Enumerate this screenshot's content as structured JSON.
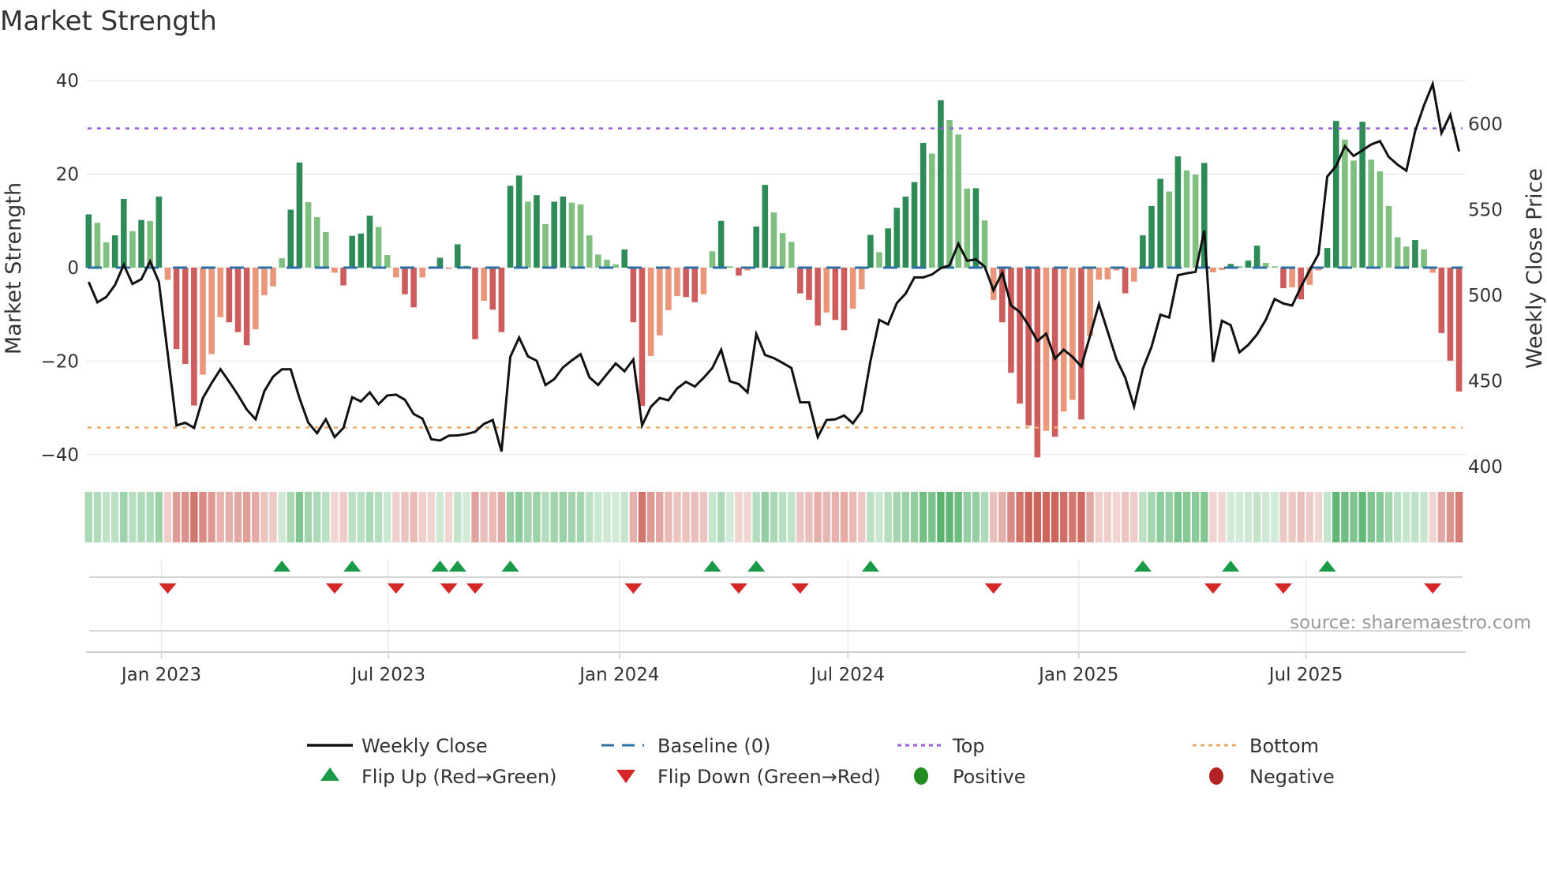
{
  "chart_data": {
    "type": "bar",
    "title": "Market Strength",
    "ylabel": "Market Strength",
    "y2label": "Weekly Close Price",
    "ylim": [
      -42,
      42
    ],
    "y2lim": [
      395,
      630
    ],
    "yticks": [
      "40",
      "20",
      "0",
      "−20",
      "−40"
    ],
    "yticks_values": [
      40,
      20,
      0,
      -20,
      -40
    ],
    "y2ticks": [
      "600",
      "550",
      "500",
      "450",
      "400"
    ],
    "y2ticks_values": [
      600,
      550,
      500,
      450,
      400
    ],
    "xticks": [
      {
        "label": "Jan 2023",
        "date": "2023-01-01"
      },
      {
        "label": "Jul 2023",
        "date": "2023-07-01"
      },
      {
        "label": "Jan 2024",
        "date": "2024-01-01"
      },
      {
        "label": "Jul 2024",
        "date": "2024-07-01"
      },
      {
        "label": "Jan 2025",
        "date": "2025-01-01"
      },
      {
        "label": "Jul 2025",
        "date": "2025-07-01"
      }
    ],
    "start_date": "2022-11-04",
    "frequency": "weekly",
    "grid": true,
    "top_level": 29.8,
    "bottom_level": -34.2,
    "baseline": 0,
    "market_strength": [
      11.4,
      9.6,
      5.4,
      6.9,
      14.7,
      7.8,
      10.2,
      10,
      15.2,
      -2.6,
      -17.4,
      -20.6,
      -29.5,
      -22.9,
      -18.5,
      -10.6,
      -11.7,
      -13.8,
      -16.6,
      -13.2,
      -5.9,
      -4,
      2,
      12.4,
      22.5,
      14,
      10.8,
      7.6,
      -1.1,
      -3.8,
      6.8,
      7.3,
      11.1,
      8.7,
      2.7,
      -2.1,
      -5.7,
      -8.5,
      -2.1,
      -0.3,
      2.1,
      -0.3,
      5,
      0.4,
      -15.3,
      -7.1,
      -9,
      -13.8,
      17.5,
      19.7,
      14.1,
      15.5,
      9.3,
      14.1,
      15.2,
      13.9,
      13.5,
      6.9,
      2.8,
      1.7,
      0.7,
      3.9,
      -11.7,
      -29.6,
      -18.9,
      -14.5,
      -9.1,
      -6.1,
      -6.3,
      -7.4,
      -5.7,
      3.5,
      10,
      0.3,
      -1.7,
      -0.6,
      8.8,
      17.7,
      11.8,
      7.4,
      5.5,
      -5.5,
      -6.9,
      -12.4,
      -9.6,
      -11.2,
      -13.4,
      -8.8,
      -4.6,
      7,
      3.3,
      8.4,
      12.8,
      15.2,
      18.3,
      26.7,
      24.4,
      35.8,
      31.6,
      28.5,
      16.9,
      17,
      10.1,
      -6.9,
      -11.7,
      -22.5,
      -29.1,
      -33.8,
      -40.6,
      -34.9,
      -36.2,
      -30.8,
      -28.3,
      -32.5,
      -14.6,
      -2.6,
      -2.5,
      -0.6,
      -5.5,
      -3,
      6.9,
      13.2,
      19,
      16.3,
      23.8,
      20.8,
      19.9,
      22.4,
      -1,
      -0.5,
      0.8,
      0.3,
      1.5,
      4.7,
      1,
      0.3,
      -4.4,
      -4.2,
      -6.8,
      -3.7,
      -0.6,
      4.2,
      31.4,
      27.4,
      22.9,
      31.2,
      23.1,
      20.6,
      13.2,
      6.5,
      4.5,
      5.9,
      3.9,
      -1.1,
      -14,
      -19.9,
      -26.5
    ],
    "weekly_close": [
      507.8,
      495.9,
      499,
      506,
      517.8,
      506.6,
      509.4,
      519.8,
      507.8,
      466,
      424,
      425.6,
      422.6,
      440,
      448.7,
      456.8,
      449.5,
      441.8,
      433.3,
      427.6,
      444,
      452.5,
      456.8,
      456.8,
      440,
      425.6,
      419.5,
      427.6,
      417.2,
      422.6,
      440.5,
      438,
      443.3,
      436.4,
      441.5,
      442,
      439,
      430.7,
      428,
      416,
      415.2,
      418,
      418.2,
      419,
      420.3,
      424.9,
      427.2,
      408.8,
      464,
      475.3,
      464.4,
      461.8,
      447.6,
      451,
      457.9,
      462,
      465.6,
      452.2,
      447.6,
      454,
      460.2,
      455.6,
      462.5,
      424,
      434.9,
      440,
      438.7,
      445.6,
      449.5,
      446.7,
      451.8,
      457.5,
      468.2,
      449.8,
      448.2,
      443.3,
      477.4,
      465.1,
      463.3,
      460.5,
      457.5,
      437.5,
      437.5,
      417.2,
      427.2,
      427.6,
      429.8,
      425.2,
      432.3,
      461.8,
      485.6,
      483,
      495.5,
      500.9,
      510.4,
      510.4,
      512.1,
      515.8,
      517.4,
      530.1,
      520.1,
      520.9,
      516.7,
      502.9,
      513.2,
      494,
      490.2,
      482.5,
      473.3,
      477.6,
      463,
      468.2,
      464,
      458.4,
      476.4,
      494.9,
      478.8,
      462.7,
      452,
      435,
      457,
      470,
      488.6,
      487,
      511.7,
      512.8,
      513.7,
      537.8,
      461,
      485.1,
      482.6,
      466.7,
      471,
      477.1,
      485.6,
      497.8,
      495.2,
      494,
      504.8,
      514.7,
      524,
      569.3,
      575.4,
      587,
      581.3,
      584.6,
      588,
      590,
      580.8,
      576.2,
      572.7,
      595.7,
      610.8,
      623.3,
      594.6,
      605.4,
      583.9
    ],
    "flip_up_weeks": [
      22,
      30,
      40,
      42,
      48,
      71,
      76,
      89,
      120,
      130,
      141
    ],
    "flip_down_weeks": [
      9,
      28,
      35,
      41,
      44,
      62,
      74,
      81,
      103,
      128,
      136,
      153
    ],
    "legend": {
      "placement": "bottom",
      "items": [
        {
          "label": "Weekly Close",
          "kind": "line"
        },
        {
          "label": "Baseline (0)",
          "kind": "dash"
        },
        {
          "label": "Top",
          "kind": "dot-purple"
        },
        {
          "label": "Bottom",
          "kind": "dot-orange"
        },
        {
          "label": "Flip Up (Red→Green)",
          "kind": "tri-up"
        },
        {
          "label": "Flip Down (Green→Red)",
          "kind": "tri-down"
        },
        {
          "label": "Positive",
          "kind": "dot-green"
        },
        {
          "label": "Negative",
          "kind": "dot-red"
        }
      ]
    },
    "source": "source: sharemaestro.com"
  },
  "colors": {
    "dark_green": "#2e8b57",
    "light_green": "#7fbf7f",
    "dark_red": "#cd5c5c",
    "light_red": "#e9967a",
    "baseline": "#2e6fa6",
    "top": "#9d5ce0",
    "bottom": "#f0a868",
    "close": "#111111",
    "flip_up": "#1a9a47",
    "flip_down": "#d62728",
    "positive": "#228b22",
    "negative": "#b22222"
  }
}
